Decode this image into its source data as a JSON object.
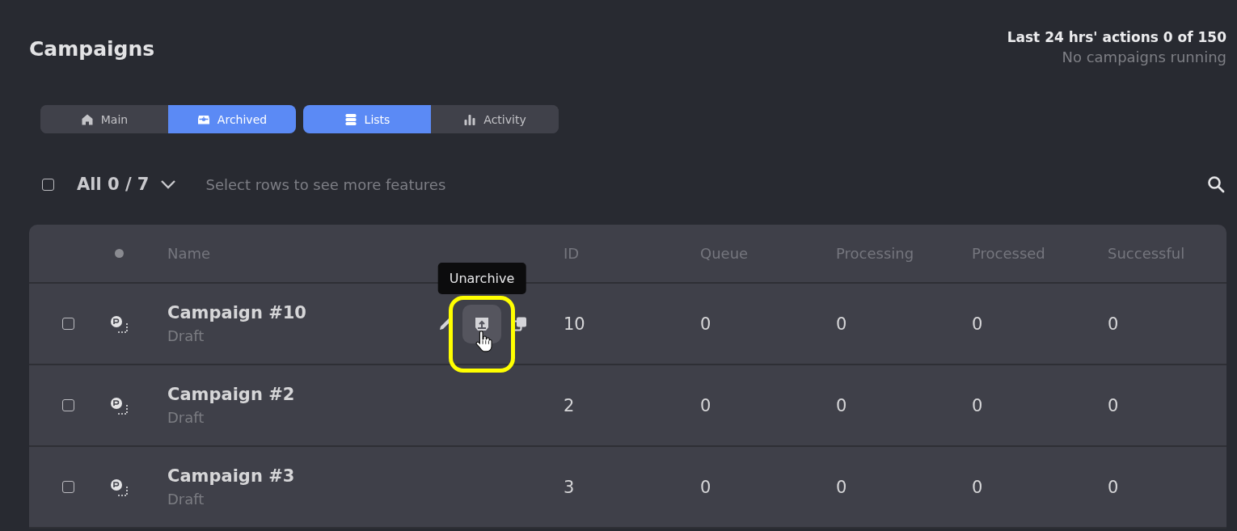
{
  "page": {
    "title": "Campaigns"
  },
  "usage": {
    "actions": "Last 24 hrs' actions 0 of 150",
    "status": "No campaigns running"
  },
  "tab_groups": [
    [
      {
        "label": "Main",
        "selected": false
      },
      {
        "label": "Archived",
        "selected": true
      }
    ],
    [
      {
        "label": "Lists",
        "selected": true
      },
      {
        "label": "Activity",
        "selected": false
      }
    ]
  ],
  "selection": {
    "checked": false,
    "count": "All 0 / 7",
    "hint": "Select rows to see more features"
  },
  "table": {
    "columns": [
      "Name",
      "ID",
      "Queue",
      "Processing",
      "Processed",
      "Successful"
    ],
    "rows": [
      {
        "checked": false,
        "name": "Campaign #10",
        "status": "Draft",
        "id": "10",
        "queue": "0",
        "processing": "0",
        "processed": "0",
        "successful": "0",
        "hovered": true,
        "tooltip": "Unarchive"
      },
      {
        "checked": false,
        "name": "Campaign #2",
        "status": "Draft",
        "id": "2",
        "queue": "0",
        "processing": "0",
        "processed": "0",
        "successful": "0",
        "hovered": false
      },
      {
        "checked": false,
        "name": "Campaign #3",
        "status": "Draft",
        "id": "3",
        "queue": "0",
        "processing": "0",
        "processed": "0",
        "successful": "0",
        "hovered": false
      }
    ]
  }
}
